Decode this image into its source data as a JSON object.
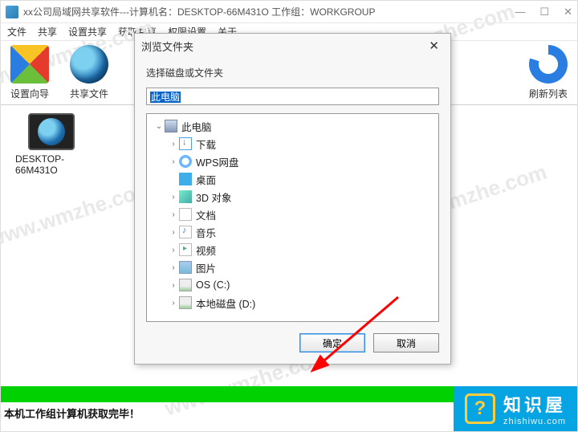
{
  "window": {
    "title": "xx公司局域网共享软件---计算机名：DESKTOP-66M431O  工作组：WORKGROUP"
  },
  "menu": {
    "m1": "文件",
    "m2": "共享",
    "m3": "设置共享",
    "m4": "获取共享",
    "m5": "权限设置",
    "m6": "关于"
  },
  "toolbar": {
    "wizard": "设置向导",
    "share": "共享文件",
    "refresh": "刷新列表"
  },
  "desktop": {
    "host": "DESKTOP-66M431O"
  },
  "dialog": {
    "title": "浏览文件夹",
    "label": "选择磁盘或文件夹",
    "path": "此电脑",
    "ok": "确定",
    "cancel": "取消",
    "tree": [
      {
        "indent": 0,
        "exp": "v",
        "icon": "ic-pc",
        "label": "此电脑"
      },
      {
        "indent": 1,
        "exp": ">",
        "icon": "ic-dl",
        "label": "下载"
      },
      {
        "indent": 1,
        "exp": ">",
        "icon": "ic-cloud",
        "label": "WPS网盘"
      },
      {
        "indent": 1,
        "exp": "",
        "icon": "ic-desk",
        "label": "桌面"
      },
      {
        "indent": 1,
        "exp": ">",
        "icon": "ic-3d",
        "label": "3D 对象"
      },
      {
        "indent": 1,
        "exp": ">",
        "icon": "ic-doc",
        "label": "文档"
      },
      {
        "indent": 1,
        "exp": ">",
        "icon": "ic-music",
        "label": "音乐"
      },
      {
        "indent": 1,
        "exp": ">",
        "icon": "ic-vid",
        "label": "视频"
      },
      {
        "indent": 1,
        "exp": ">",
        "icon": "ic-pic",
        "label": "图片"
      },
      {
        "indent": 1,
        "exp": ">",
        "icon": "ic-drv",
        "label": "OS (C:)"
      },
      {
        "indent": 1,
        "exp": ">",
        "icon": "ic-drv",
        "label": "本地磁盘 (D:)"
      }
    ]
  },
  "status": "本机工作组计算机获取完毕！",
  "watermark": "www.wmzhe.com",
  "badge": {
    "title": "知识屋",
    "sub": "zhishiwu.com"
  }
}
